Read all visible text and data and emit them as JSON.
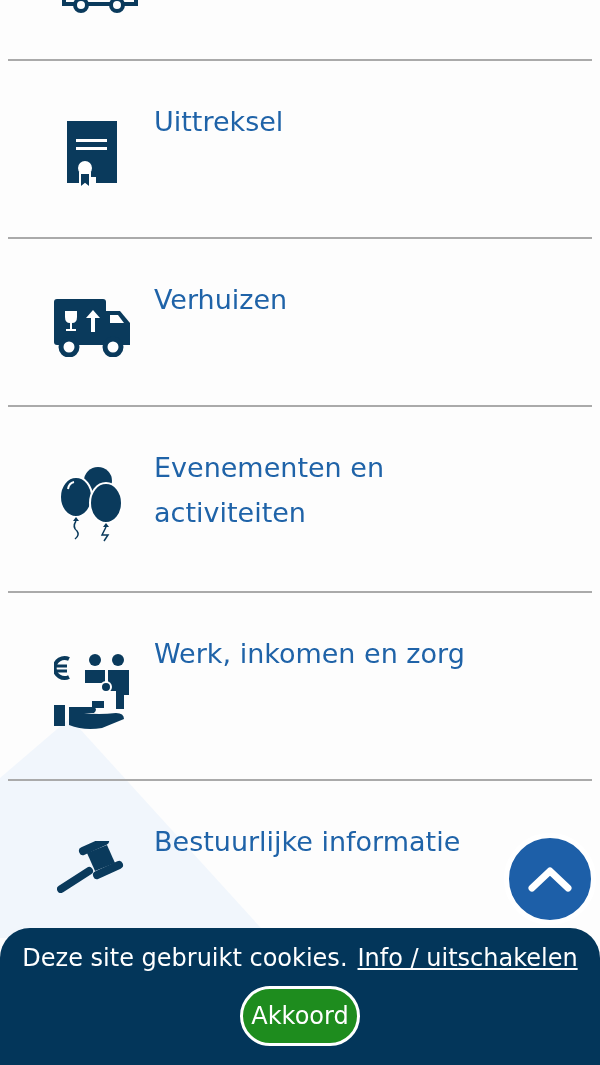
{
  "items": [
    {
      "kind": "car"
    },
    {
      "kind": "document",
      "label": "Uittreksel"
    },
    {
      "kind": "truck",
      "label": "Verhuizen"
    },
    {
      "kind": "balloons",
      "label": "Evenementen en activiteiten"
    },
    {
      "kind": "care",
      "label": "Werk, inkomen en zorg"
    },
    {
      "kind": "gavel",
      "label": "Bestuurlijke informatie"
    }
  ],
  "cookie_banner": {
    "text": "Deze site gebruikt cookies.",
    "link": "Info / uitschakelen",
    "button": "Akkoord"
  }
}
